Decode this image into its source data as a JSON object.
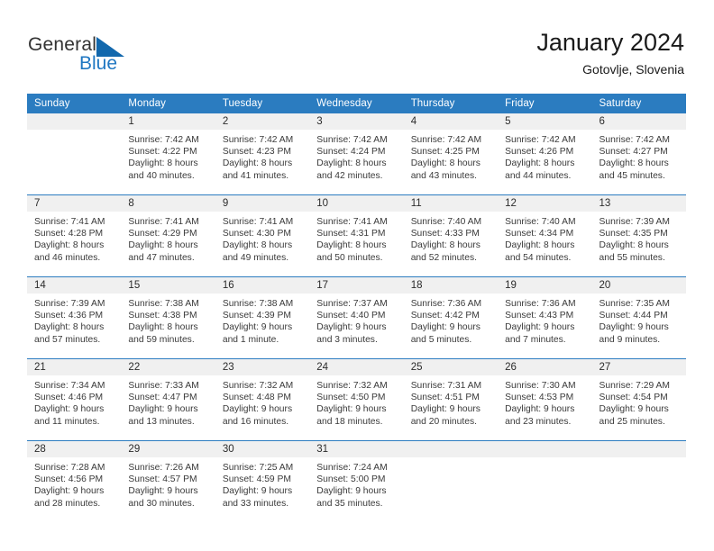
{
  "brand": {
    "name_part1": "General",
    "name_part2": "Blue",
    "logo_icon": "triangle-flag-icon"
  },
  "header": {
    "title": "January 2024",
    "location": "Gotovlje, Slovenia"
  },
  "colors": {
    "header_blue": "#2b7cc0",
    "brand_blue": "#1268ad",
    "daynum_band": "#f0f0f0",
    "page_background": "#ffffff"
  },
  "weekday_headers": [
    "Sunday",
    "Monday",
    "Tuesday",
    "Wednesday",
    "Thursday",
    "Friday",
    "Saturday"
  ],
  "weeks": [
    [
      {
        "day": "",
        "sunrise": "",
        "sunset": "",
        "daylight1": "",
        "daylight2": "",
        "state": "empty"
      },
      {
        "day": "1",
        "sunrise": "Sunrise: 7:42 AM",
        "sunset": "Sunset: 4:22 PM",
        "daylight1": "Daylight: 8 hours",
        "daylight2": "and 40 minutes.",
        "state": "filled"
      },
      {
        "day": "2",
        "sunrise": "Sunrise: 7:42 AM",
        "sunset": "Sunset: 4:23 PM",
        "daylight1": "Daylight: 8 hours",
        "daylight2": "and 41 minutes.",
        "state": "filled"
      },
      {
        "day": "3",
        "sunrise": "Sunrise: 7:42 AM",
        "sunset": "Sunset: 4:24 PM",
        "daylight1": "Daylight: 8 hours",
        "daylight2": "and 42 minutes.",
        "state": "filled"
      },
      {
        "day": "4",
        "sunrise": "Sunrise: 7:42 AM",
        "sunset": "Sunset: 4:25 PM",
        "daylight1": "Daylight: 8 hours",
        "daylight2": "and 43 minutes.",
        "state": "filled"
      },
      {
        "day": "5",
        "sunrise": "Sunrise: 7:42 AM",
        "sunset": "Sunset: 4:26 PM",
        "daylight1": "Daylight: 8 hours",
        "daylight2": "and 44 minutes.",
        "state": "filled"
      },
      {
        "day": "6",
        "sunrise": "Sunrise: 7:42 AM",
        "sunset": "Sunset: 4:27 PM",
        "daylight1": "Daylight: 8 hours",
        "daylight2": "and 45 minutes.",
        "state": "filled"
      }
    ],
    [
      {
        "day": "7",
        "sunrise": "Sunrise: 7:41 AM",
        "sunset": "Sunset: 4:28 PM",
        "daylight1": "Daylight: 8 hours",
        "daylight2": "and 46 minutes.",
        "state": "filled"
      },
      {
        "day": "8",
        "sunrise": "Sunrise: 7:41 AM",
        "sunset": "Sunset: 4:29 PM",
        "daylight1": "Daylight: 8 hours",
        "daylight2": "and 47 minutes.",
        "state": "filled"
      },
      {
        "day": "9",
        "sunrise": "Sunrise: 7:41 AM",
        "sunset": "Sunset: 4:30 PM",
        "daylight1": "Daylight: 8 hours",
        "daylight2": "and 49 minutes.",
        "state": "filled"
      },
      {
        "day": "10",
        "sunrise": "Sunrise: 7:41 AM",
        "sunset": "Sunset: 4:31 PM",
        "daylight1": "Daylight: 8 hours",
        "daylight2": "and 50 minutes.",
        "state": "filled"
      },
      {
        "day": "11",
        "sunrise": "Sunrise: 7:40 AM",
        "sunset": "Sunset: 4:33 PM",
        "daylight1": "Daylight: 8 hours",
        "daylight2": "and 52 minutes.",
        "state": "filled"
      },
      {
        "day": "12",
        "sunrise": "Sunrise: 7:40 AM",
        "sunset": "Sunset: 4:34 PM",
        "daylight1": "Daylight: 8 hours",
        "daylight2": "and 54 minutes.",
        "state": "filled"
      },
      {
        "day": "13",
        "sunrise": "Sunrise: 7:39 AM",
        "sunset": "Sunset: 4:35 PM",
        "daylight1": "Daylight: 8 hours",
        "daylight2": "and 55 minutes.",
        "state": "filled"
      }
    ],
    [
      {
        "day": "14",
        "sunrise": "Sunrise: 7:39 AM",
        "sunset": "Sunset: 4:36 PM",
        "daylight1": "Daylight: 8 hours",
        "daylight2": "and 57 minutes.",
        "state": "filled"
      },
      {
        "day": "15",
        "sunrise": "Sunrise: 7:38 AM",
        "sunset": "Sunset: 4:38 PM",
        "daylight1": "Daylight: 8 hours",
        "daylight2": "and 59 minutes.",
        "state": "filled"
      },
      {
        "day": "16",
        "sunrise": "Sunrise: 7:38 AM",
        "sunset": "Sunset: 4:39 PM",
        "daylight1": "Daylight: 9 hours",
        "daylight2": "and 1 minute.",
        "state": "filled"
      },
      {
        "day": "17",
        "sunrise": "Sunrise: 7:37 AM",
        "sunset": "Sunset: 4:40 PM",
        "daylight1": "Daylight: 9 hours",
        "daylight2": "and 3 minutes.",
        "state": "filled"
      },
      {
        "day": "18",
        "sunrise": "Sunrise: 7:36 AM",
        "sunset": "Sunset: 4:42 PM",
        "daylight1": "Daylight: 9 hours",
        "daylight2": "and 5 minutes.",
        "state": "filled"
      },
      {
        "day": "19",
        "sunrise": "Sunrise: 7:36 AM",
        "sunset": "Sunset: 4:43 PM",
        "daylight1": "Daylight: 9 hours",
        "daylight2": "and 7 minutes.",
        "state": "filled"
      },
      {
        "day": "20",
        "sunrise": "Sunrise: 7:35 AM",
        "sunset": "Sunset: 4:44 PM",
        "daylight1": "Daylight: 9 hours",
        "daylight2": "and 9 minutes.",
        "state": "filled"
      }
    ],
    [
      {
        "day": "21",
        "sunrise": "Sunrise: 7:34 AM",
        "sunset": "Sunset: 4:46 PM",
        "daylight1": "Daylight: 9 hours",
        "daylight2": "and 11 minutes.",
        "state": "filled"
      },
      {
        "day": "22",
        "sunrise": "Sunrise: 7:33 AM",
        "sunset": "Sunset: 4:47 PM",
        "daylight1": "Daylight: 9 hours",
        "daylight2": "and 13 minutes.",
        "state": "filled"
      },
      {
        "day": "23",
        "sunrise": "Sunrise: 7:32 AM",
        "sunset": "Sunset: 4:48 PM",
        "daylight1": "Daylight: 9 hours",
        "daylight2": "and 16 minutes.",
        "state": "filled"
      },
      {
        "day": "24",
        "sunrise": "Sunrise: 7:32 AM",
        "sunset": "Sunset: 4:50 PM",
        "daylight1": "Daylight: 9 hours",
        "daylight2": "and 18 minutes.",
        "state": "filled"
      },
      {
        "day": "25",
        "sunrise": "Sunrise: 7:31 AM",
        "sunset": "Sunset: 4:51 PM",
        "daylight1": "Daylight: 9 hours",
        "daylight2": "and 20 minutes.",
        "state": "filled"
      },
      {
        "day": "26",
        "sunrise": "Sunrise: 7:30 AM",
        "sunset": "Sunset: 4:53 PM",
        "daylight1": "Daylight: 9 hours",
        "daylight2": "and 23 minutes.",
        "state": "filled"
      },
      {
        "day": "27",
        "sunrise": "Sunrise: 7:29 AM",
        "sunset": "Sunset: 4:54 PM",
        "daylight1": "Daylight: 9 hours",
        "daylight2": "and 25 minutes.",
        "state": "filled"
      }
    ],
    [
      {
        "day": "28",
        "sunrise": "Sunrise: 7:28 AM",
        "sunset": "Sunset: 4:56 PM",
        "daylight1": "Daylight: 9 hours",
        "daylight2": "and 28 minutes.",
        "state": "filled"
      },
      {
        "day": "29",
        "sunrise": "Sunrise: 7:26 AM",
        "sunset": "Sunset: 4:57 PM",
        "daylight1": "Daylight: 9 hours",
        "daylight2": "and 30 minutes.",
        "state": "filled"
      },
      {
        "day": "30",
        "sunrise": "Sunrise: 7:25 AM",
        "sunset": "Sunset: 4:59 PM",
        "daylight1": "Daylight: 9 hours",
        "daylight2": "and 33 minutes.",
        "state": "filled"
      },
      {
        "day": "31",
        "sunrise": "Sunrise: 7:24 AM",
        "sunset": "Sunset: 5:00 PM",
        "daylight1": "Daylight: 9 hours",
        "daylight2": "and 35 minutes.",
        "state": "filled"
      },
      {
        "day": "",
        "sunrise": "",
        "sunset": "",
        "daylight1": "",
        "daylight2": "",
        "state": "empty"
      },
      {
        "day": "",
        "sunrise": "",
        "sunset": "",
        "daylight1": "",
        "daylight2": "",
        "state": "empty"
      },
      {
        "day": "",
        "sunrise": "",
        "sunset": "",
        "daylight1": "",
        "daylight2": "",
        "state": "empty"
      }
    ]
  ]
}
